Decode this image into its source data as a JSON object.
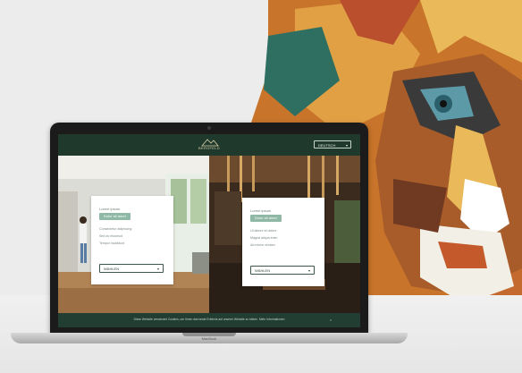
{
  "site": {
    "logo_text": "BERGFELD",
    "language": "DEUTSCH"
  },
  "panels": [
    {
      "overline": "Lorem ipsum",
      "pill": "Dolor sit amet",
      "items": [
        "Consectetur adipiscing",
        "Sed do eiusmod",
        "Tempor incididunt"
      ],
      "dropdown": "WÄHLEN"
    },
    {
      "overline": "Lorem ipsum",
      "pill": "Dolor sit amet",
      "items": [
        "Ut labore et dolore",
        "Magna aliqua enim",
        "Ad minim veniam"
      ],
      "dropdown": "WÄHLEN"
    }
  ],
  "footer": {
    "notice": "Diese Website verwendet Cookies, um Ihnen das beste Erlebnis auf unserer Website zu bieten. Mehr Informationen",
    "close": "×"
  },
  "device_label": "MacBook",
  "colors": {
    "brand_dark": "#223d31",
    "accent": "#8fb8a6",
    "logo_gold": "#d9cfa8"
  }
}
